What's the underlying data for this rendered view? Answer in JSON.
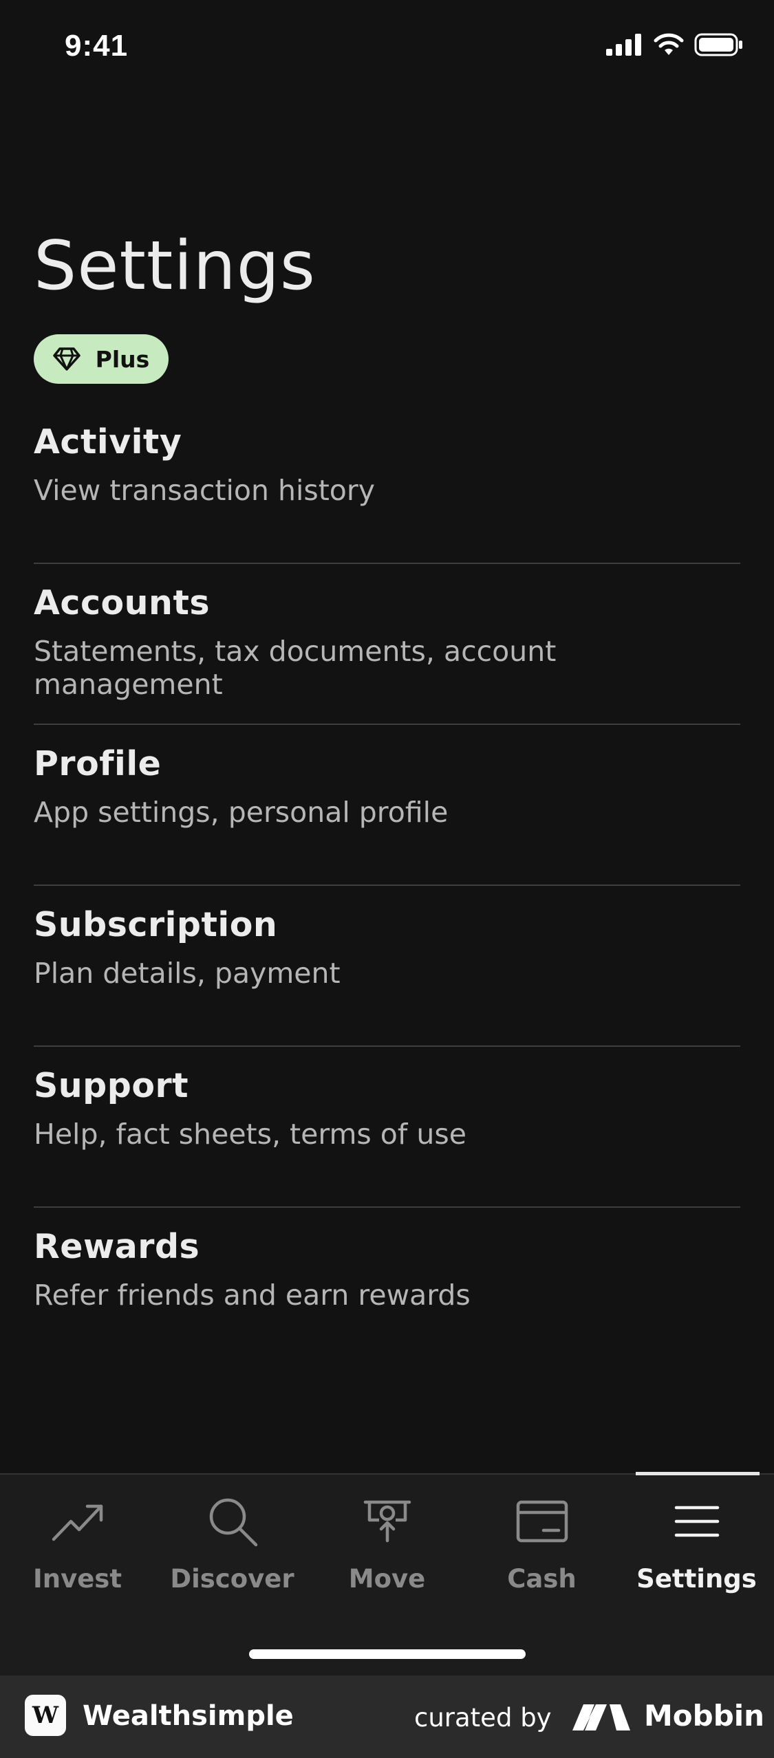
{
  "status_bar": {
    "time": "9:41",
    "icons": [
      "cellular-signal-icon",
      "wifi-icon",
      "battery-icon"
    ]
  },
  "page": {
    "title": "Settings",
    "plan_badge": {
      "icon": "diamond-icon",
      "label": "Plus",
      "color": "#c7eac0"
    }
  },
  "menu": {
    "items": [
      {
        "title": "Activity",
        "subtitle": "View transaction history"
      },
      {
        "title": "Accounts",
        "subtitle": "Statements, tax documents, account management"
      },
      {
        "title": "Profile",
        "subtitle": "App settings, personal profile"
      },
      {
        "title": "Subscription",
        "subtitle": "Plan details, payment"
      },
      {
        "title": "Support",
        "subtitle": "Help, fact sheets, terms of use"
      },
      {
        "title": "Rewards",
        "subtitle": "Refer friends and earn rewards"
      }
    ]
  },
  "tab_bar": {
    "active": "Settings",
    "tabs": [
      {
        "label": "Invest",
        "icon": "trending-up-icon"
      },
      {
        "label": "Discover",
        "icon": "search-icon"
      },
      {
        "label": "Move",
        "icon": "move-money-icon"
      },
      {
        "label": "Cash",
        "icon": "card-icon"
      },
      {
        "label": "Settings",
        "icon": "menu-icon"
      }
    ]
  },
  "footer": {
    "logo_letter": "W",
    "app_name": "Wealthsimple",
    "curated_by": "curated by",
    "brand": "Mobbin"
  },
  "colors": {
    "background": "#121212",
    "tab_bar": "#1c1c1c",
    "badge": "#c7eac0",
    "inactive_tab": "#8a8a8a"
  }
}
